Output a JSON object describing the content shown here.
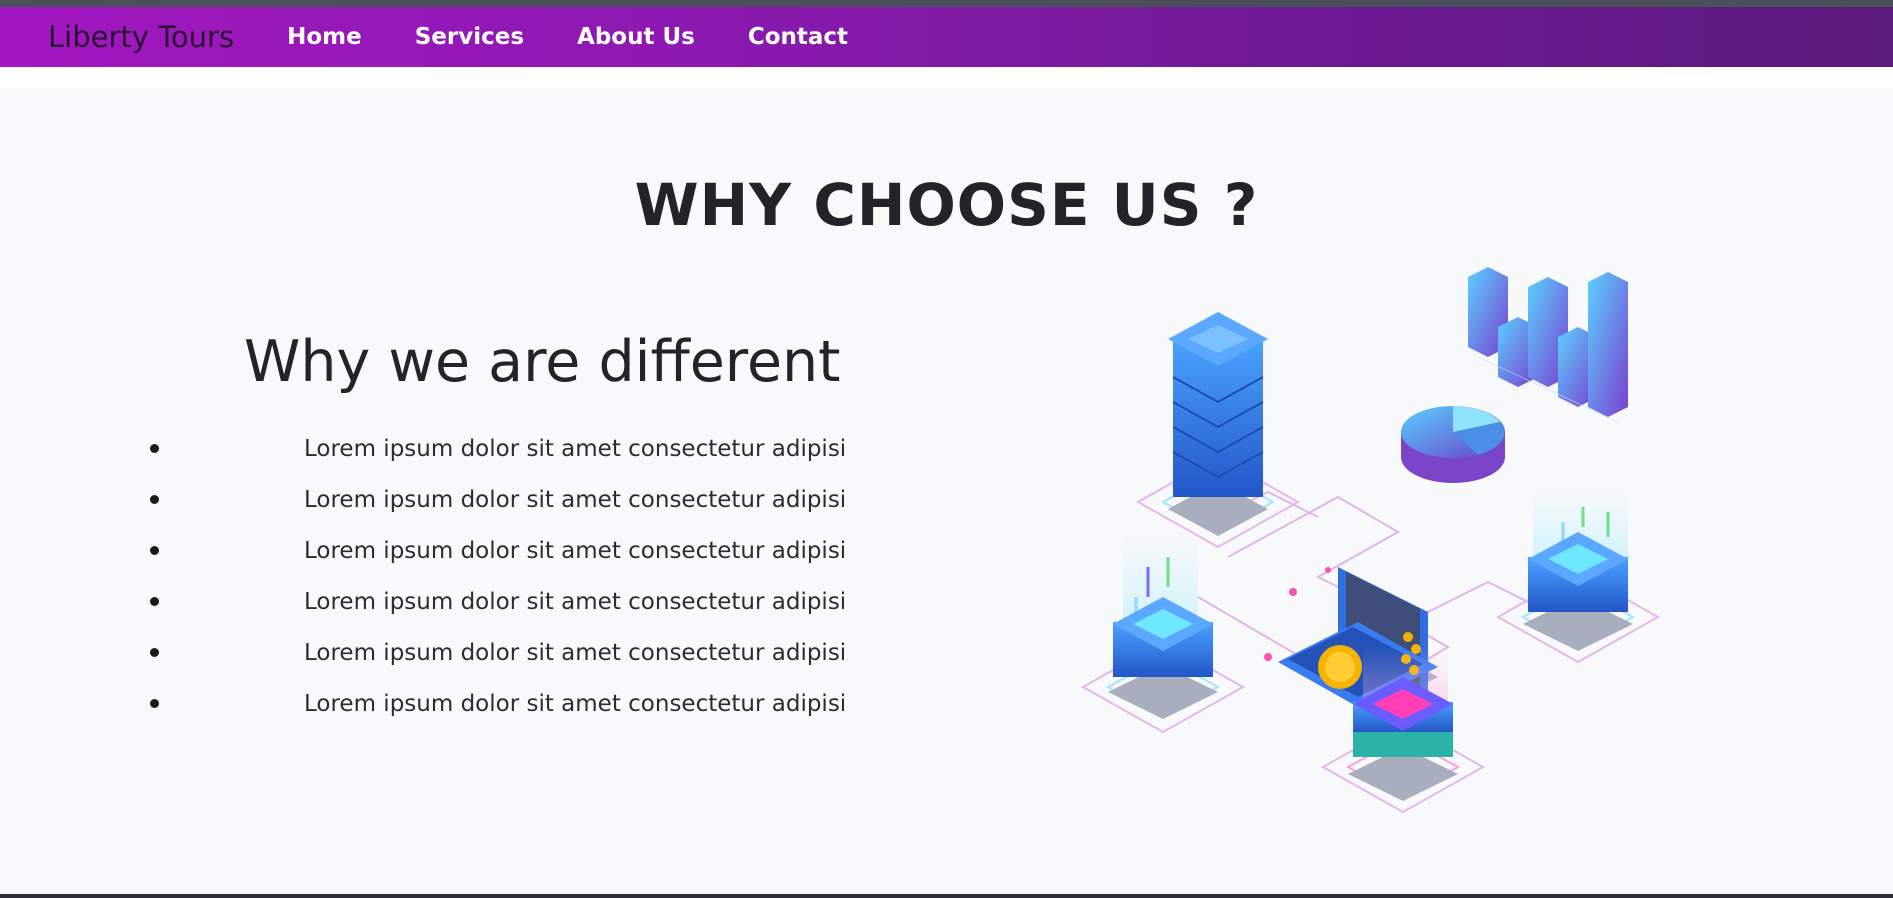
{
  "navbar": {
    "brand": "Liberty Tours",
    "links": [
      "Home",
      "Services",
      "About Us",
      "Contact"
    ]
  },
  "section": {
    "title": "WHY CHOOSE US ?",
    "subtitle": "Why we are different",
    "items": [
      "Lorem ipsum dolor sit amet consectetur adipisi",
      "Lorem ipsum dolor sit amet consectetur adipisi",
      "Lorem ipsum dolor sit amet consectetur adipisi",
      "Lorem ipsum dolor sit amet consectetur adipisi",
      "Lorem ipsum dolor sit amet consectetur adipisi",
      "Lorem ipsum dolor sit amet consectetur adipisi"
    ]
  },
  "illustration": {
    "icon": "isometric-server-network-illustration",
    "accent_blue": "#3a7bd5",
    "accent_purple": "#8e44ad",
    "accent_pink": "#e84393",
    "accent_cyan": "#4fd1ff"
  }
}
